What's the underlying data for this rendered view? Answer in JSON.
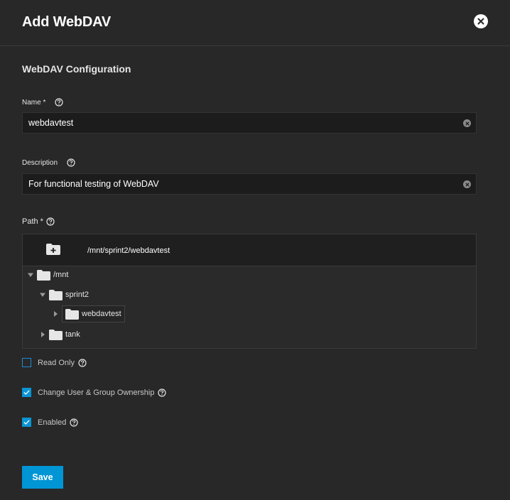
{
  "dialog": {
    "title": "Add WebDAV"
  },
  "section": {
    "title": "WebDAV Configuration"
  },
  "name": {
    "label": "Name *",
    "value": "webdavtest"
  },
  "description": {
    "label": "Description",
    "value": "For functional testing of WebDAV"
  },
  "path": {
    "label": "Path *",
    "current": "/mnt/sprint2/webdavtest",
    "tree": [
      {
        "label": "/mnt",
        "expanded": true
      },
      {
        "label": "sprint2",
        "expanded": true
      },
      {
        "label": "webdavtest",
        "expanded": false,
        "selected": true
      },
      {
        "label": "tank",
        "expanded": false
      }
    ]
  },
  "checkboxes": {
    "read_only": {
      "label": "Read Only",
      "checked": false
    },
    "change_ownership": {
      "label": "Change User & Group Ownership",
      "checked": true
    },
    "enabled": {
      "label": "Enabled",
      "checked": true
    }
  },
  "actions": {
    "save": "Save"
  },
  "colors": {
    "background": "#282828",
    "input": "#1c1c1c",
    "accent": "#0095d5"
  },
  "icons": {
    "close": "close-icon",
    "help": "help-icon",
    "clear": "clear-icon",
    "folder": "folder-icon",
    "add_folder": "add-folder-icon"
  }
}
